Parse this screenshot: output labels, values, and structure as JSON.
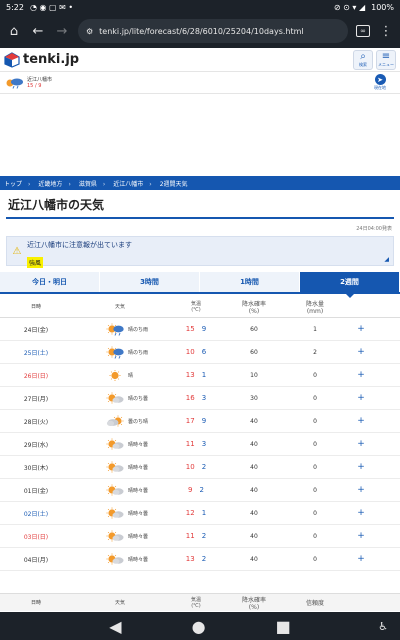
{
  "status": {
    "time": "5:22",
    "battery": "100%"
  },
  "browser": {
    "url": "tenki.jp/lite/forecast/6/28/6010/25204/10days.html",
    "tab_count": "∞"
  },
  "site": {
    "logo_text": "tenki.jp",
    "search_label": "検索",
    "menu_label": "メニュー"
  },
  "subheader": {
    "city": "近江八幡市",
    "temps": "15 / 9",
    "geo_label": "現在地"
  },
  "breadcrumb": [
    "トップ",
    "近畿地方",
    "滋賀県",
    "近江八幡市",
    "2週間天気"
  ],
  "page": {
    "title": "近江八幡市の天気",
    "updated": "24日04:00発表"
  },
  "warning": {
    "text": "近江八幡市に注意報が出ています",
    "badge": "強風",
    "arrow": "◢"
  },
  "tabs": [
    {
      "label": "今日・明日",
      "active": false
    },
    {
      "label": "3時間",
      "active": false
    },
    {
      "label": "1時間",
      "active": false
    },
    {
      "label": "2週間",
      "active": true
    }
  ],
  "table": {
    "headers": {
      "date": "日時",
      "weather": "天気",
      "temp": "気温",
      "temp_unit": "(℃)",
      "prob": "降水確率",
      "prob_unit": "(%)",
      "rain": "降水量",
      "rain_unit": "(mm)"
    },
    "rows": [
      {
        "date": "24日(金)",
        "dow": "weekday",
        "icon": "sun-then-rain-icon",
        "weather": "晴のち雨",
        "hi": "15",
        "lo": "9",
        "prob": "60",
        "rain": "1"
      },
      {
        "date": "25日(土)",
        "dow": "sat",
        "icon": "sun-then-rain-icon",
        "weather": "晴のち雨",
        "hi": "10",
        "lo": "6",
        "prob": "60",
        "rain": "2"
      },
      {
        "date": "26日(日)",
        "dow": "sun",
        "icon": "sun-icon",
        "weather": "晴",
        "hi": "13",
        "lo": "1",
        "prob": "10",
        "rain": "0"
      },
      {
        "date": "27日(月)",
        "dow": "weekday",
        "icon": "sun-then-cloud-icon",
        "weather": "晴のち曇",
        "hi": "16",
        "lo": "3",
        "prob": "30",
        "rain": "0"
      },
      {
        "date": "28日(火)",
        "dow": "weekday",
        "icon": "cloud-then-sun-icon",
        "weather": "曇のち晴",
        "hi": "17",
        "lo": "9",
        "prob": "40",
        "rain": "0"
      },
      {
        "date": "29日(水)",
        "dow": "weekday",
        "icon": "sun-sometimes-cloud-icon",
        "weather": "晴時々曇",
        "hi": "11",
        "lo": "3",
        "prob": "40",
        "rain": "0"
      },
      {
        "date": "30日(木)",
        "dow": "weekday",
        "icon": "sun-sometimes-cloud-icon",
        "weather": "晴時々曇",
        "hi": "10",
        "lo": "2",
        "prob": "40",
        "rain": "0"
      },
      {
        "date": "01日(金)",
        "dow": "weekday",
        "icon": "sun-sometimes-cloud-icon",
        "weather": "晴時々曇",
        "hi": "9",
        "lo": "2",
        "prob": "40",
        "rain": "0"
      },
      {
        "date": "02日(土)",
        "dow": "sat",
        "icon": "sun-sometimes-cloud-icon",
        "weather": "晴時々曇",
        "hi": "12",
        "lo": "1",
        "prob": "40",
        "rain": "0"
      },
      {
        "date": "03日(日)",
        "dow": "sun",
        "icon": "sun-sometimes-cloud-icon",
        "weather": "晴時々曇",
        "hi": "11",
        "lo": "2",
        "prob": "40",
        "rain": "0"
      },
      {
        "date": "04日(月)",
        "dow": "weekday",
        "icon": "sun-sometimes-cloud-icon",
        "weather": "晴時々曇",
        "hi": "13",
        "lo": "2",
        "prob": "40",
        "rain": "0"
      }
    ],
    "plus": "+",
    "footer": {
      "date": "日時",
      "weather": "天気",
      "temp": "気温",
      "temp_unit": "(℃)",
      "prob": "降水確率",
      "prob_unit": "(%)",
      "reliability": "信頼度"
    }
  },
  "colors": {
    "brand_blue": "#1557b0",
    "high_red": "#e23b3b",
    "low_blue": "#1a5bb4",
    "warn_yellow": "#f9f000"
  }
}
